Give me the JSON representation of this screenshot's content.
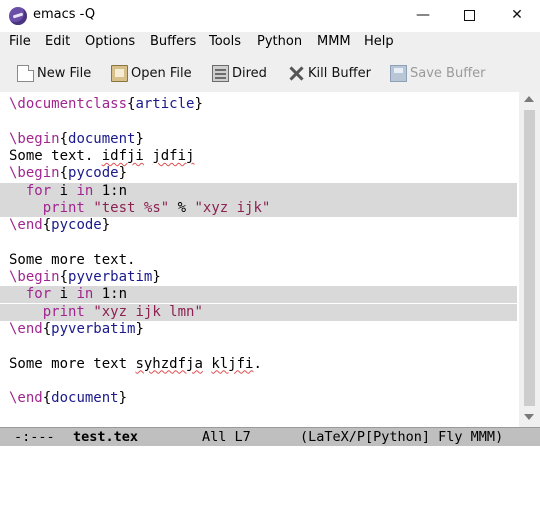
{
  "window": {
    "title": "emacs -Q"
  },
  "menubar": [
    "File",
    "Edit",
    "Options",
    "Buffers",
    "Tools",
    "Python",
    "MMM",
    "Help"
  ],
  "toolbar": {
    "new_file": "New File",
    "open_file": "Open File",
    "dired": "Dired",
    "kill_buffer": "Kill Buffer",
    "save_buffer": "Save Buffer"
  },
  "editor": {
    "lines": [
      {
        "parts": [
          {
            "t": "\\documentclass",
            "c": "kw-cmd"
          },
          {
            "t": "{"
          },
          {
            "t": "article",
            "c": "kw-arg"
          },
          {
            "t": "}"
          }
        ]
      },
      {
        "parts": []
      },
      {
        "parts": [
          {
            "t": "\\begin",
            "c": "kw-cmd"
          },
          {
            "t": "{"
          },
          {
            "t": "document",
            "c": "kw-arg"
          },
          {
            "t": "}"
          }
        ]
      },
      {
        "parts": [
          {
            "t": "Some text. "
          },
          {
            "t": "idfji",
            "c": "spell"
          },
          {
            "t": " "
          },
          {
            "t": "jdfij",
            "c": "spell"
          }
        ]
      },
      {
        "parts": [
          {
            "t": "\\begin",
            "c": "kw-cmd"
          },
          {
            "t": "{"
          },
          {
            "t": "pycode",
            "c": "kw-arg"
          },
          {
            "t": "}"
          }
        ]
      },
      {
        "hl": true,
        "parts": [
          {
            "t": "  "
          },
          {
            "t": "for",
            "c": "py-kw"
          },
          {
            "t": " i "
          },
          {
            "t": "in",
            "c": "py-kw"
          },
          {
            "t": " 1:n"
          }
        ]
      },
      {
        "hl": true,
        "parts": [
          {
            "t": "    "
          },
          {
            "t": "print",
            "c": "py-kw"
          },
          {
            "t": " "
          },
          {
            "t": "\"test %s\"",
            "c": "py-str"
          },
          {
            "t": " % "
          },
          {
            "t": "\"xyz ijk\"",
            "c": "py-str"
          }
        ]
      },
      {
        "parts": [
          {
            "t": "\\end",
            "c": "kw-cmd"
          },
          {
            "t": "{"
          },
          {
            "t": "pycode",
            "c": "kw-arg"
          },
          {
            "t": "}"
          }
        ]
      },
      {
        "parts": []
      },
      {
        "parts": [
          {
            "t": "Some more text."
          }
        ]
      },
      {
        "parts": [
          {
            "t": "\\begin",
            "c": "kw-cmd"
          },
          {
            "t": "{"
          },
          {
            "t": "pyverbatim",
            "c": "kw-arg"
          },
          {
            "t": "}"
          }
        ]
      },
      {
        "hl": true,
        "parts": [
          {
            "t": "  "
          },
          {
            "t": "for",
            "c": "py-kw"
          },
          {
            "t": " i "
          },
          {
            "t": "in",
            "c": "py-kw"
          },
          {
            "t": " 1:n"
          }
        ]
      },
      {
        "hl": true,
        "parts": [
          {
            "t": "    "
          },
          {
            "t": "print",
            "c": "py-kw"
          },
          {
            "t": " "
          },
          {
            "t": "\"xyz ijk lmn\"",
            "c": "py-str"
          }
        ]
      },
      {
        "parts": [
          {
            "t": "\\end",
            "c": "kw-cmd"
          },
          {
            "t": "{"
          },
          {
            "t": "pyverbatim",
            "c": "kw-arg"
          },
          {
            "t": "}"
          }
        ]
      },
      {
        "parts": []
      },
      {
        "parts": [
          {
            "t": "Some more text "
          },
          {
            "t": "syhzdfja",
            "c": "spell"
          },
          {
            "t": " "
          },
          {
            "t": "kljfi",
            "c": "spell"
          },
          {
            "t": "."
          }
        ]
      },
      {
        "parts": []
      },
      {
        "parts": [
          {
            "t": "\\end",
            "c": "kw-cmd"
          },
          {
            "t": "{"
          },
          {
            "t": "document",
            "c": "kw-arg"
          },
          {
            "t": "}"
          }
        ]
      }
    ]
  },
  "modeline": {
    "status": "-:---",
    "filename": "test.tex",
    "position": "All L7",
    "modes": "(LaTeX/P[Python] Fly MMM)"
  },
  "icons": {
    "app": "emacs-icon",
    "minimize": "minimize-icon",
    "maximize": "maximize-icon",
    "close": "close-icon",
    "new_file": "new-file-icon",
    "open_file": "open-folder-icon",
    "dired": "dired-icon",
    "kill_buffer": "kill-buffer-icon",
    "save_buffer": "save-icon"
  }
}
